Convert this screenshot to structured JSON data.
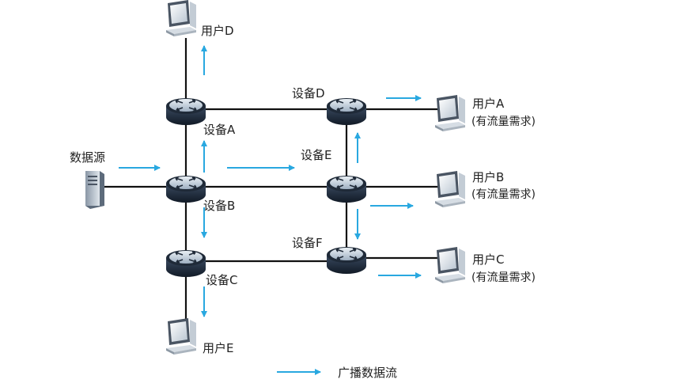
{
  "colors": {
    "link": "#111111",
    "broadcast_arrow": "#29a8e0",
    "router_dark": "#1f2a38",
    "router_mid": "#3a4a60",
    "router_light": "#c9d4df",
    "pc_dark": "#4a5563",
    "pc_light": "#e8eef3",
    "server": "#6b7a8c"
  },
  "devices": {
    "a": "设备A",
    "b": "设备B",
    "c": "设备C",
    "d": "设备D",
    "e": "设备E",
    "f": "设备F"
  },
  "users": {
    "a": "用户A",
    "b": "用户B",
    "c": "用户C",
    "d": "用户D",
    "e": "用户E"
  },
  "demand_note": "(有流量需求)",
  "source_label": "数据源",
  "legend_label": "广播数据流",
  "icons": {
    "router": "router-icon",
    "pc": "pc-icon",
    "server": "server-icon"
  }
}
